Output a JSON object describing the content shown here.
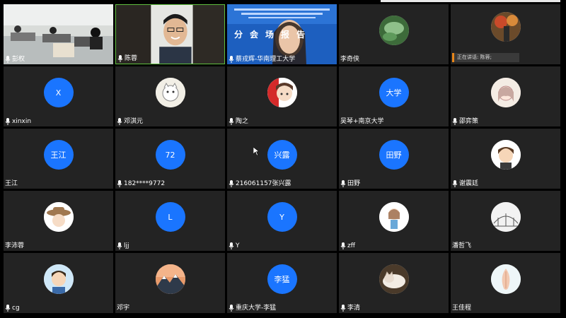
{
  "meeting": {
    "speaking_label": "正在讲话: 陈蓉;",
    "video_banner_text": "分会场报告",
    "participants": [
      {
        "name": "彭权",
        "mic": true,
        "type": "video"
      },
      {
        "name": "陈蓉",
        "mic": true,
        "type": "video"
      },
      {
        "name": "蔡戎辉-华南理工大学",
        "mic": true,
        "type": "video"
      },
      {
        "name": "李奇侠",
        "mic": false,
        "type": "avatar-image",
        "avatar_icon": "leaf-photo-avatar"
      },
      {
        "name": "",
        "mic": false,
        "type": "avatar-image",
        "avatar_icon": "autumn-photo-avatar"
      },
      {
        "name": "xinxin",
        "mic": true,
        "type": "avatar-text",
        "avatar_text": "X"
      },
      {
        "name": "邓淇元",
        "mic": true,
        "type": "avatar-image",
        "avatar_icon": "cartoon-cat-avatar"
      },
      {
        "name": "陶之",
        "mic": true,
        "type": "avatar-image",
        "avatar_icon": "anime-girl-avatar"
      },
      {
        "name": "吴琴+南京大学",
        "mic": false,
        "type": "avatar-text",
        "avatar_text": "大学"
      },
      {
        "name": "邵弈策",
        "mic": true,
        "type": "avatar-image",
        "avatar_icon": "sketch-girl-avatar"
      },
      {
        "name": "王江",
        "mic": false,
        "type": "avatar-text",
        "avatar_text": "王江"
      },
      {
        "name": "182****9772",
        "mic": true,
        "type": "avatar-text",
        "avatar_text": "72"
      },
      {
        "name": "216061157张兴露",
        "mic": true,
        "type": "avatar-text",
        "avatar_text": "兴露"
      },
      {
        "name": "田野",
        "mic": true,
        "type": "avatar-text",
        "avatar_text": "田野"
      },
      {
        "name": "谢震廷",
        "mic": true,
        "type": "avatar-image",
        "avatar_icon": "cartoon-boy-avatar"
      },
      {
        "name": "李沛蓉",
        "mic": false,
        "type": "avatar-image",
        "avatar_icon": "hat-girl-avatar"
      },
      {
        "name": "ljj",
        "mic": true,
        "type": "avatar-text",
        "avatar_text": "L"
      },
      {
        "name": "Y",
        "mic": true,
        "type": "avatar-text",
        "avatar_text": "Y"
      },
      {
        "name": "zff",
        "mic": true,
        "type": "avatar-image",
        "avatar_icon": "doll-girl-avatar"
      },
      {
        "name": "潘哲飞",
        "mic": false,
        "type": "avatar-image",
        "avatar_icon": "bridge-sketch-avatar"
      },
      {
        "name": "cg",
        "mic": true,
        "type": "avatar-image",
        "avatar_icon": "cartoon-man-avatar"
      },
      {
        "name": "邓宇",
        "mic": false,
        "type": "avatar-image",
        "avatar_icon": "mountain-photo-avatar"
      },
      {
        "name": "重庆大学-李猛",
        "mic": true,
        "type": "avatar-text",
        "avatar_text": "李猛"
      },
      {
        "name": "李清",
        "mic": true,
        "type": "avatar-image",
        "avatar_icon": "sleeping-cat-avatar"
      },
      {
        "name": "王佳程",
        "mic": false,
        "type": "avatar-image",
        "avatar_icon": "seashell-avatar"
      }
    ]
  },
  "colors": {
    "avatar_blue": "#1a75ff",
    "tile_bg": "#232323",
    "speaking_accent": "#e8861a"
  }
}
